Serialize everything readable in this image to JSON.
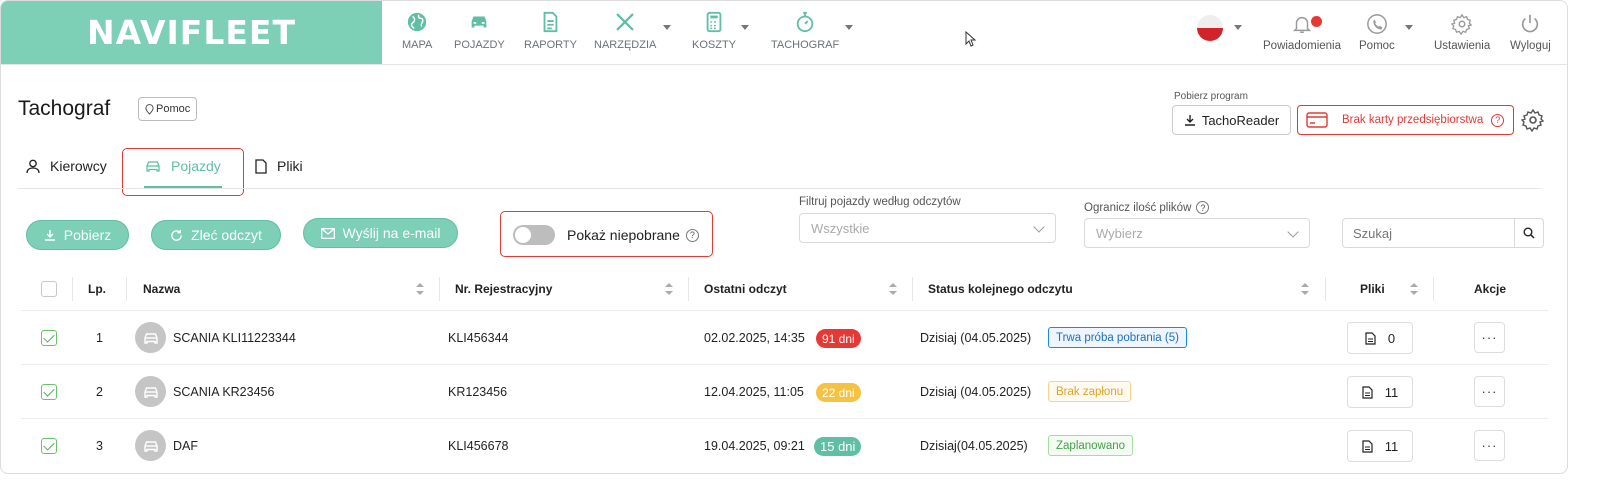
{
  "logo": "NAVIFLEET",
  "nav": [
    {
      "label": "MAPA",
      "icon": "globe-icon"
    },
    {
      "label": "POJAZDY",
      "icon": "car-icon"
    },
    {
      "label": "RAPORTY",
      "icon": "report-icon"
    },
    {
      "label": "NARZĘDZIA",
      "icon": "tools-icon"
    },
    {
      "label": "KOSZTY",
      "icon": "calculator-icon"
    },
    {
      "label": "TACHOGRAF",
      "icon": "stopwatch-icon"
    }
  ],
  "right_nav": {
    "notifications": "Powiadomienia",
    "help": "Pomoc",
    "settings": "Ustawienia",
    "logout": "Wyloguj"
  },
  "page": {
    "title": "Tachograf",
    "help_chip": "Pomoc",
    "download_label": "Pobierz program",
    "tachoreader": "TachoReader",
    "company_card": "Brak karty przedsiębiorstwa"
  },
  "tabs": [
    {
      "label": "Kierowcy",
      "active": false
    },
    {
      "label": "Pojazdy",
      "active": true
    },
    {
      "label": "Pliki",
      "active": false
    }
  ],
  "actions": {
    "download": "Pobierz",
    "order_read": "Zleć odczyt",
    "send_email": "Wyślij na e-mail",
    "show_not_downloaded": "Pokaż niepobrane"
  },
  "filters": {
    "readings_label": "Filtruj pojazdy według odczytów",
    "readings_value": "Wszystkie",
    "limit_label": "Ogranicz ilość plików",
    "limit_placeholder": "Wybierz",
    "search_placeholder": "Szukaj"
  },
  "table": {
    "headers": {
      "lp": "Lp.",
      "name": "Nazwa",
      "reg": "Nr. Rejestracyjny",
      "last_read": "Ostatni odczyt",
      "next_status": "Status kolejnego odczytu",
      "files": "Pliki",
      "actions": "Akcje"
    },
    "rows": [
      {
        "lp": "1",
        "name": "SCANIA KLI11223344",
        "reg": "KLI456344",
        "last_read": "02.02.2025, 14:35",
        "days": "91 dni",
        "days_color": "#e53935",
        "next": "Dzisiaj (04.05.2025)",
        "status": "Trwa próba pobrania (5)",
        "files": "0",
        "more": "···"
      },
      {
        "lp": "2",
        "name": "SCANIA KR23456",
        "reg": "KR123456",
        "last_read": "12.04.2025, 11:05",
        "days": "22 dni",
        "days_color": "#f5c242",
        "next": "Dzisiaj (04.05.2025)",
        "status": "Brak zapłonu",
        "files": "11",
        "more": "···"
      },
      {
        "lp": "3",
        "name": "DAF",
        "reg": "KLI456678",
        "last_read": "19.04.2025, 09:21",
        "days": "15 dni",
        "days_color": "#5fbfa4",
        "next": "Dzisiaj(04.05.2025)",
        "status": "Zaplanowano",
        "files": "11",
        "more": "···"
      }
    ]
  },
  "colors": {
    "brand": "#7dcfb6",
    "accent": "#5fbfa4",
    "alert": "#e53935"
  }
}
